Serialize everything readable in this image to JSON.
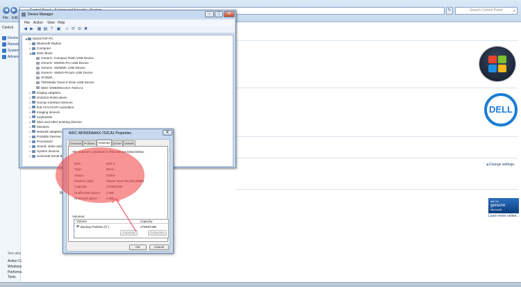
{
  "control_panel": {
    "breadcrumb": "▸ Control Panel ▸ System and Security ▸ System",
    "search_placeholder": "Search Control Panel",
    "menu": [
      "File",
      "Edit"
    ],
    "left_links": [
      "Device M",
      "Remote",
      "System",
      "Advance"
    ],
    "left_header": "Control",
    "see_also": "See also",
    "see_also_links": [
      "Action Center",
      "Windows Update",
      "Performance Information and",
      "Tools"
    ],
    "change_settings": "Change settings",
    "genuine": {
      "line1": "ask for",
      "line2": "genuine",
      "line3": "Microsoft",
      "line4": "software"
    },
    "learn_more": "Learn more online...",
    "dell_logo": "DELL",
    "stray_text": "W"
  },
  "device_manager": {
    "title": "Device Manager",
    "menu": [
      "File",
      "Action",
      "View",
      "Help"
    ],
    "tree": [
      {
        "label": "DESKTOP-PC",
        "level": 0,
        "exp": "◢"
      },
      {
        "label": "Bluetooth Radios",
        "level": 1,
        "exp": "▷"
      },
      {
        "label": "Computer",
        "level": 1,
        "exp": "▷"
      },
      {
        "label": "Disk drives",
        "level": 1,
        "exp": "◢"
      },
      {
        "label": "Generic- Compact Flash USB Device",
        "level": 2,
        "exp": "",
        "disk": true
      },
      {
        "label": "Generic- MS/MS-Pro USB Device",
        "level": 2,
        "exp": "",
        "disk": true
      },
      {
        "label": "Generic- SD/MMC USB Device",
        "level": 2,
        "exp": "",
        "disk": true
      },
      {
        "label": "Generic- SM/xD-Picture USB Device",
        "level": 2,
        "exp": "",
        "disk": true
      },
      {
        "label": "ST3500...",
        "level": 2,
        "exp": "",
        "disk": true
      },
      {
        "label": "TDKMedia Trans-It Drive USB Device",
        "level": 2,
        "exp": "",
        "disk": true
      },
      {
        "label": "WDC WD5000AAKX-753CA1",
        "level": 2,
        "exp": "",
        "disk": true
      },
      {
        "label": "Display adapters",
        "level": 1,
        "exp": "▷"
      },
      {
        "label": "DVD/CD-ROM drives",
        "level": 1,
        "exp": "▷"
      },
      {
        "label": "Human Interface Devices",
        "level": 1,
        "exp": "▷"
      },
      {
        "label": "IDE ATA/ATAPI controllers",
        "level": 1,
        "exp": "▷"
      },
      {
        "label": "Imaging devices",
        "level": 1,
        "exp": "▷"
      },
      {
        "label": "Keyboards",
        "level": 1,
        "exp": "▷"
      },
      {
        "label": "Mice and other pointing devices",
        "level": 1,
        "exp": "▷"
      },
      {
        "label": "Monitors",
        "level": 1,
        "exp": "▷"
      },
      {
        "label": "Network adapters",
        "level": 1,
        "exp": "▷"
      },
      {
        "label": "Portable Devices",
        "level": 1,
        "exp": "▷"
      },
      {
        "label": "Processors",
        "level": 1,
        "exp": "▷"
      },
      {
        "label": "Sound, video and",
        "level": 1,
        "exp": "▷"
      },
      {
        "label": "System devices",
        "level": 1,
        "exp": "▷"
      },
      {
        "label": "Universal Serial B",
        "level": 1,
        "exp": "▷"
      }
    ]
  },
  "properties": {
    "title": "WDC WD5000AAKX-753CA1 Properties",
    "tabs": [
      "General",
      "Policies",
      "Volumes",
      "Driver",
      "Details"
    ],
    "active_tab": "Volumes",
    "description": "The volumes contained on this disk are listed below.",
    "props": [
      {
        "label": "Disk:",
        "value": "Disk 0"
      },
      {
        "label": "Type:",
        "value": "Basic"
      },
      {
        "label": "Status:",
        "value": "Online"
      },
      {
        "label": "Partition style:",
        "value": "Master Boot Record (MBR)"
      },
      {
        "label": "Capacity:",
        "value": "476938 MB"
      },
      {
        "label": "Unallocated space:",
        "value": "1 MB"
      },
      {
        "label": "Reserved space:",
        "value": "0 MB"
      }
    ],
    "volumes_caption": "Volumes:",
    "volume_headers": [
      "Volume",
      "Capacity"
    ],
    "volume_rows": [
      {
        "name": "Backup Partition (F:)",
        "capacity": "476930 MB"
      }
    ],
    "populate_label": "Populate",
    "properties_label": "Properties",
    "ok_label": "OK",
    "cancel_label": "Cancel"
  }
}
